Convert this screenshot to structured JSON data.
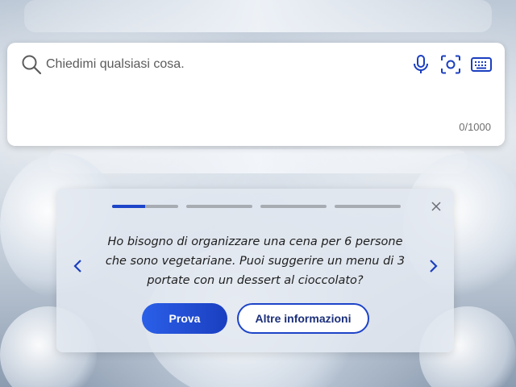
{
  "search": {
    "placeholder": "Chiedimi qualsiasi cosa.",
    "counter": "0/1000",
    "icons": [
      "search-icon",
      "microphone-icon",
      "camera-icon",
      "keyboard-icon"
    ]
  },
  "card": {
    "progress": {
      "segments": 4,
      "active_index": 0,
      "active_fill_fraction": 0.5
    },
    "prompt": "Ho bisogno di organizzare una cena per 6 persone che sono vegetariane. Puoi suggerire un menu di 3 portate con un dessert al cioccolato?",
    "primary_button": "Prova",
    "secondary_button": "Altre informazioni"
  },
  "colors": {
    "accent": "#1d44c8",
    "icon_blue": "#1b3fc0"
  }
}
